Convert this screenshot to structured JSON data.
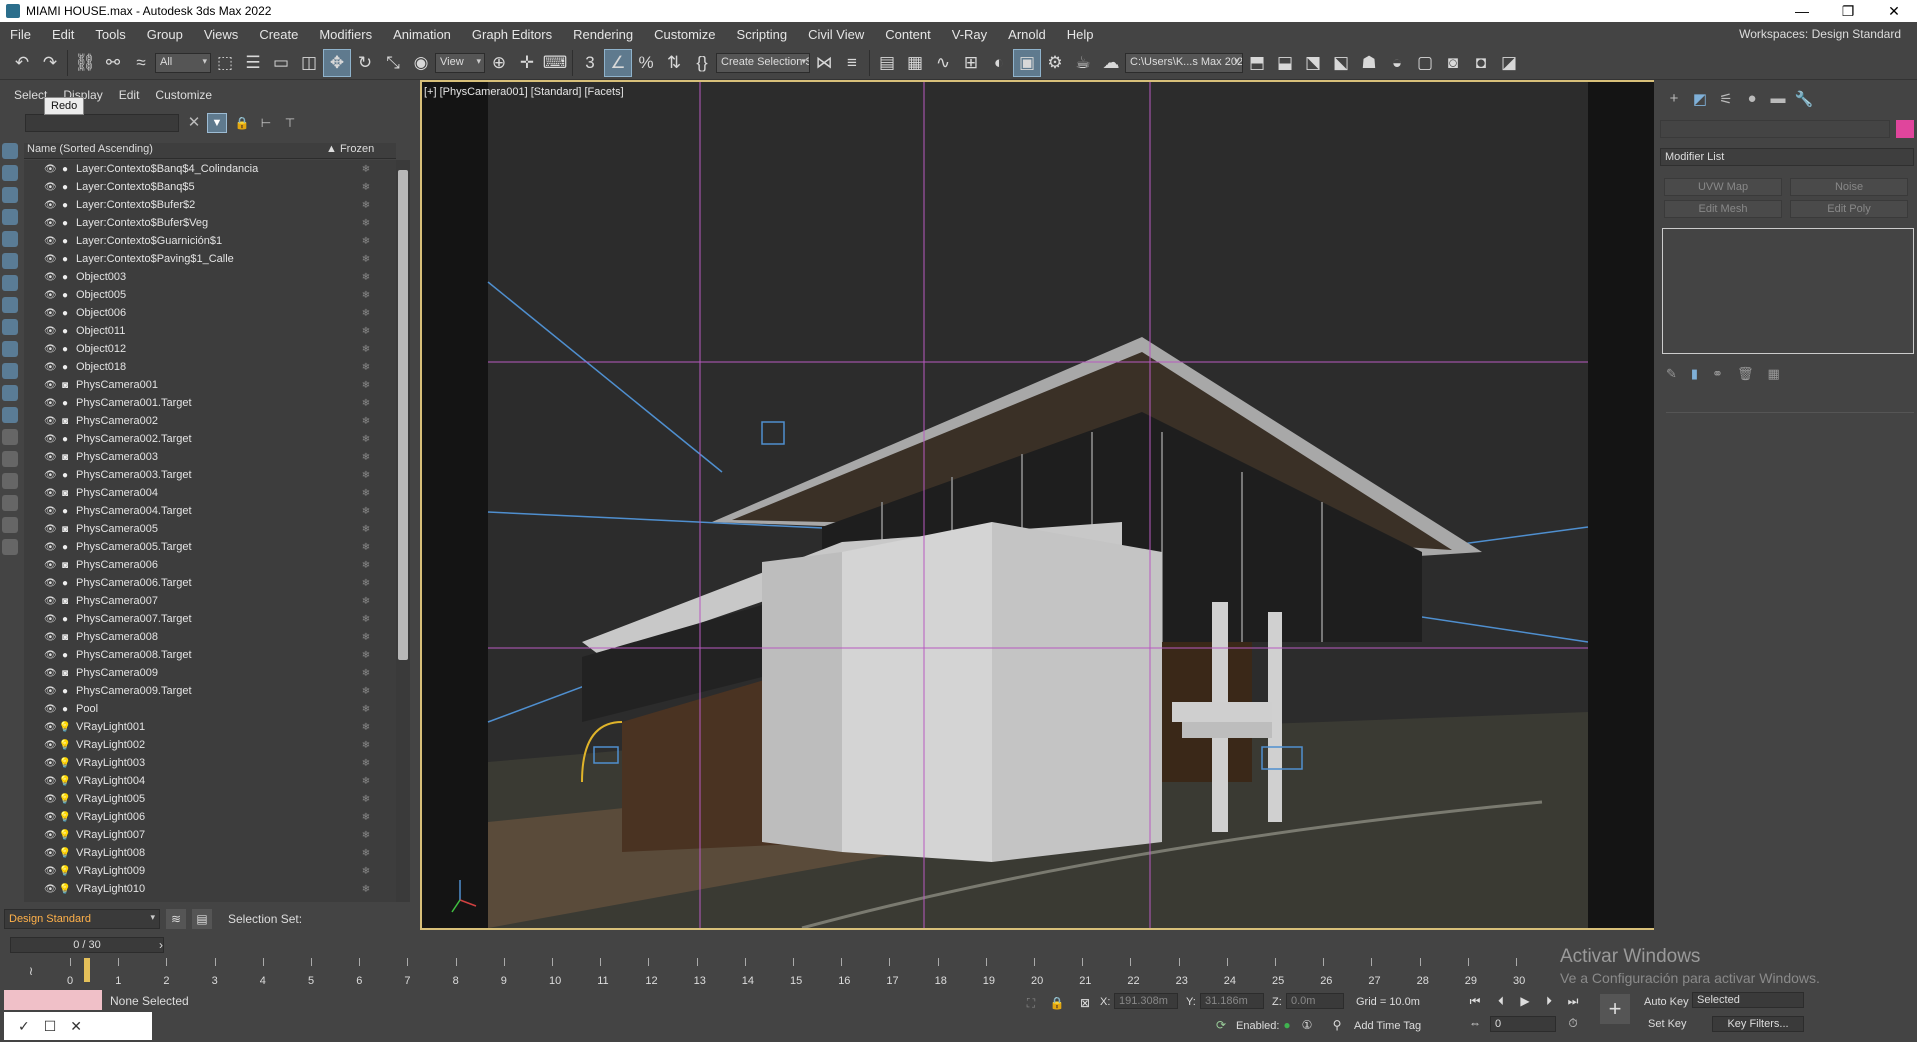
{
  "window": {
    "title": "MIAMI HOUSE.max - Autodesk 3ds Max 2022",
    "buttons": [
      "—",
      "❐",
      "✕"
    ]
  },
  "menu": {
    "items": [
      "File",
      "Edit",
      "Tools",
      "Group",
      "Views",
      "Create",
      "Modifiers",
      "Animation",
      "Graph Editors",
      "Rendering",
      "Customize",
      "Scripting",
      "Civil View",
      "Content",
      "V-Ray",
      "Arnold",
      "Help"
    ],
    "workspaces_label": "Workspaces:",
    "workspaces_value": "Design Standard"
  },
  "toolbar": {
    "selection_filter": "All",
    "ref_coord": "View",
    "named_selection": "Create Selection Se",
    "project_path": "C:\\Users\\K...s Max 2022"
  },
  "explorer": {
    "tabs": [
      "Select",
      "Display",
      "Edit",
      "Customize"
    ],
    "tooltip": "Redo",
    "header_name": "Name (Sorted Ascending)",
    "header_frozen": "Frozen",
    "rows": [
      {
        "name": "Layer:Contexto$Banq$4_Colindancia",
        "type": "geo"
      },
      {
        "name": "Layer:Contexto$Banq$5",
        "type": "geo"
      },
      {
        "name": "Layer:Contexto$Bufer$2",
        "type": "geo"
      },
      {
        "name": "Layer:Contexto$Bufer$Veg",
        "type": "geo"
      },
      {
        "name": "Layer:Contexto$Guarnición$1",
        "type": "geo"
      },
      {
        "name": "Layer:Contexto$Paving$1_Calle",
        "type": "geo"
      },
      {
        "name": "Object003",
        "type": "geo"
      },
      {
        "name": "Object005",
        "type": "geo"
      },
      {
        "name": "Object006",
        "type": "geo"
      },
      {
        "name": "Object011",
        "type": "geo"
      },
      {
        "name": "Object012",
        "type": "geo"
      },
      {
        "name": "Object018",
        "type": "geo"
      },
      {
        "name": "PhysCamera001",
        "type": "cam"
      },
      {
        "name": "PhysCamera001.Target",
        "type": "tgt"
      },
      {
        "name": "PhysCamera002",
        "type": "cam"
      },
      {
        "name": "PhysCamera002.Target",
        "type": "tgt"
      },
      {
        "name": "PhysCamera003",
        "type": "cam"
      },
      {
        "name": "PhysCamera003.Target",
        "type": "tgt"
      },
      {
        "name": "PhysCamera004",
        "type": "cam"
      },
      {
        "name": "PhysCamera004.Target",
        "type": "tgt"
      },
      {
        "name": "PhysCamera005",
        "type": "cam"
      },
      {
        "name": "PhysCamera005.Target",
        "type": "tgt"
      },
      {
        "name": "PhysCamera006",
        "type": "cam"
      },
      {
        "name": "PhysCamera006.Target",
        "type": "tgt"
      },
      {
        "name": "PhysCamera007",
        "type": "cam"
      },
      {
        "name": "PhysCamera007.Target",
        "type": "tgt"
      },
      {
        "name": "PhysCamera008",
        "type": "cam"
      },
      {
        "name": "PhysCamera008.Target",
        "type": "tgt"
      },
      {
        "name": "PhysCamera009",
        "type": "cam"
      },
      {
        "name": "PhysCamera009.Target",
        "type": "tgt"
      },
      {
        "name": "Pool",
        "type": "geo"
      },
      {
        "name": "VRayLight001",
        "type": "light"
      },
      {
        "name": "VRayLight002",
        "type": "light"
      },
      {
        "name": "VRayLight003",
        "type": "light"
      },
      {
        "name": "VRayLight004",
        "type": "light"
      },
      {
        "name": "VRayLight005",
        "type": "light"
      },
      {
        "name": "VRayLight006",
        "type": "light"
      },
      {
        "name": "VRayLight007",
        "type": "light"
      },
      {
        "name": "VRayLight008",
        "type": "light"
      },
      {
        "name": "VRayLight009",
        "type": "light"
      },
      {
        "name": "VRayLight010",
        "type": "light"
      }
    ],
    "layer_dropdown": "Design Standard",
    "selection_set_label": "Selection Set:"
  },
  "viewport": {
    "label": "[+] [PhysCamera001] [Standard] [Facets]"
  },
  "command_panel": {
    "modifier_list": "Modifier List",
    "buttons": [
      "UVW Map",
      "Noise",
      "Edit Mesh",
      "Edit Poly"
    ]
  },
  "timeline": {
    "frame_display": "0 / 30",
    "ticks": [
      "0",
      "1",
      "2",
      "3",
      "4",
      "5",
      "6",
      "7",
      "8",
      "9",
      "10",
      "11",
      "12",
      "13",
      "14",
      "15",
      "16",
      "17",
      "18",
      "19",
      "20",
      "21",
      "22",
      "23",
      "24",
      "25",
      "26",
      "27",
      "28",
      "29",
      "30"
    ],
    "current_frame": 0
  },
  "status": {
    "selection": "None Selected",
    "x_label": "X:",
    "x_value": "191.308m",
    "y_label": "Y:",
    "y_value": "31.186m",
    "z_label": "Z:",
    "z_value": "0.0m",
    "grid": "Grid = 10.0m",
    "auto_key": "Auto Key",
    "set_key": "Set Key",
    "key_mode": "Selected",
    "key_filters": "Key Filters...",
    "enabled_label": "Enabled:",
    "add_time_tag": "Add Time Tag",
    "frame_field": "0"
  },
  "watermark": {
    "line1": "Activar Windows",
    "line2": "Ve a Configuración para activar Windows."
  }
}
